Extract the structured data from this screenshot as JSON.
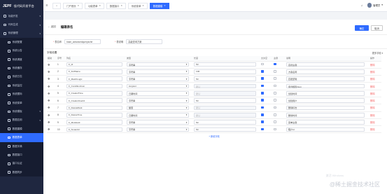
{
  "app": {
    "logo": "JEPF",
    "tag": "低代码开发平台"
  },
  "sidebar": {
    "items": [
      {
        "label": "功能开发",
        "icon": "code-icon",
        "sub": false,
        "caret": true
      },
      {
        "label": "代码生成",
        "icon": "file-icon",
        "sub": false,
        "caret": true
      },
      {
        "label": "系统管理",
        "icon": "gear-icon",
        "sub": false,
        "caret": true
      },
      {
        "label": "系统配置",
        "icon": "settings-icon",
        "sub": true
      },
      {
        "label": "系统公告",
        "icon": "bell-icon",
        "sub": true
      },
      {
        "label": "系统调度",
        "icon": "clock-icon",
        "sub": true
      },
      {
        "label": "系统缓存",
        "icon": "database-icon",
        "sub": true
      },
      {
        "label": "系统日志",
        "icon": "log-icon",
        "sub": true
      },
      {
        "label": "系统监控",
        "icon": "monitor-icon",
        "sub": true
      },
      {
        "label": "系统图标",
        "icon": "image-icon",
        "sub": true
      },
      {
        "label": "系统菜单",
        "icon": "menu-icon",
        "sub": true
      },
      {
        "label": "系统模板",
        "icon": "template-icon",
        "sub": true,
        "caret": true
      },
      {
        "label": "数据应用",
        "icon": "app-icon",
        "sub": true,
        "caret": true
      },
      {
        "label": "数据建模",
        "icon": "model-icon",
        "sub": true
      },
      {
        "label": "数据表单",
        "icon": "form-icon",
        "sub": true,
        "active": true
      },
      {
        "label": "数据字典",
        "icon": "book-icon",
        "sub": true
      },
      {
        "label": "数据接口",
        "icon": "api-icon",
        "sub": true
      },
      {
        "label": "接口认证",
        "icon": "key-icon",
        "sub": true
      },
      {
        "label": "数据同步",
        "icon": "sync-icon",
        "sub": true
      }
    ]
  },
  "tabs": [
    {
      "label": "门户首页"
    },
    {
      "label": "功能表单"
    },
    {
      "label": "数据接口"
    },
    {
      "label": "系统菜单"
    },
    {
      "label": "数据建模",
      "active": true
    }
  ],
  "user": {
    "name": "管理员"
  },
  "header": {
    "back": "返回",
    "title": "编辑表名",
    "confirm": "确定",
    "cancel": "取消"
  },
  "form": {
    "table_label": "表名称",
    "table_value": "base_advancedquerysche",
    "desc_label": "表说明",
    "desc_value": "高级查询方案"
  },
  "section": {
    "title": "字段设置",
    "options": "更多字段 ▾"
  },
  "columns": [
    "拖动",
    "序号",
    "列名",
    "类型",
    "长度",
    "允许空",
    "主键",
    "说明",
    "操作"
  ],
  "rows": [
    {
      "no": "1",
      "name": "F_Id",
      "type": "字符串",
      "len": "50",
      "nullable": false,
      "pk": true,
      "desc": "自然主键",
      "len_dis": false
    },
    {
      "no": "2",
      "name": "F_FullName",
      "type": "字符串",
      "len": "100",
      "nullable": true,
      "pk": false,
      "desc": "方案名称",
      "len_dis": false
    },
    {
      "no": "3",
      "name": "F_MatchLogic",
      "type": "字符串",
      "len": "50",
      "nullable": true,
      "pk": false,
      "desc": "匹配逻辑",
      "len_dis": false
    },
    {
      "no": "4",
      "name": "F_ConditionJson",
      "type": "longtext",
      "len": "默认",
      "nullable": true,
      "pk": false,
      "desc": "条件规则Json",
      "len_dis": true
    },
    {
      "no": "5",
      "name": "F_CreatorTime",
      "type": "日期时间",
      "len": "默认",
      "nullable": true,
      "pk": false,
      "desc": "创建时间",
      "len_dis": true
    },
    {
      "no": "6",
      "name": "F_CreatorUserId",
      "type": "字符串",
      "len": "50",
      "nullable": true,
      "pk": false,
      "desc": "创建用户",
      "len_dis": false
    },
    {
      "no": "7",
      "name": "F_DeleteMark",
      "type": "整型",
      "len": "默认",
      "nullable": true,
      "pk": false,
      "desc": "删除标志",
      "len_dis": true
    },
    {
      "no": "8",
      "name": "F_DeleteTime",
      "type": "日期时间",
      "len": "默认",
      "nullable": true,
      "pk": false,
      "desc": "删除时间",
      "len_dis": true
    },
    {
      "no": "9",
      "name": "F_ModuleId",
      "type": "字符串",
      "len": "50",
      "nullable": true,
      "pk": false,
      "desc": "菜单主键",
      "len_dis": false
    },
    {
      "no": "10",
      "name": "F_TenantId",
      "type": "字符串",
      "len": "50",
      "nullable": true,
      "pk": false,
      "desc": "租户id",
      "len_dis": false
    }
  ],
  "row_delete": "删除",
  "add_field": "+ 新增字段",
  "watermark": "@稀土掘金技术社区",
  "watermark2": "激活 Windows",
  "colors": {
    "sidebar": "#1f2740",
    "accent": "#2f6bff",
    "danger": "#f56c6c"
  }
}
